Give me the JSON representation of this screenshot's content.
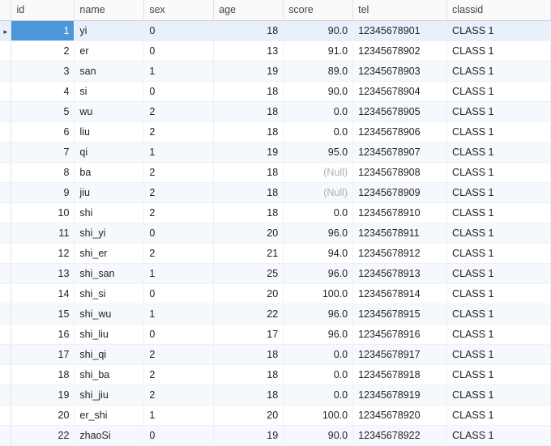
{
  "columns": {
    "id": "id",
    "name": "name",
    "sex": "sex",
    "age": "age",
    "score": "score",
    "tel": "tel",
    "classid": "classid"
  },
  "null_text": "(Null)",
  "selected_index": 0,
  "row_marker_glyph": "▸",
  "rows": [
    {
      "id": "1",
      "name": "yi",
      "sex": "0",
      "age": "18",
      "score": "90.0",
      "score_null": false,
      "tel": "12345678901",
      "classid": "CLASS 1"
    },
    {
      "id": "2",
      "name": "er",
      "sex": "0",
      "age": "13",
      "score": "91.0",
      "score_null": false,
      "tel": "12345678902",
      "classid": "CLASS 1"
    },
    {
      "id": "3",
      "name": "san",
      "sex": "1",
      "age": "19",
      "score": "89.0",
      "score_null": false,
      "tel": "12345678903",
      "classid": "CLASS 1"
    },
    {
      "id": "4",
      "name": "si",
      "sex": "0",
      "age": "18",
      "score": "90.0",
      "score_null": false,
      "tel": "12345678904",
      "classid": "CLASS 1"
    },
    {
      "id": "5",
      "name": "wu",
      "sex": "2",
      "age": "18",
      "score": "0.0",
      "score_null": false,
      "tel": "12345678905",
      "classid": "CLASS 1"
    },
    {
      "id": "6",
      "name": "liu",
      "sex": "2",
      "age": "18",
      "score": "0.0",
      "score_null": false,
      "tel": "12345678906",
      "classid": "CLASS 1"
    },
    {
      "id": "7",
      "name": "qi",
      "sex": "1",
      "age": "19",
      "score": "95.0",
      "score_null": false,
      "tel": "12345678907",
      "classid": "CLASS 1"
    },
    {
      "id": "8",
      "name": "ba",
      "sex": "2",
      "age": "18",
      "score": "",
      "score_null": true,
      "tel": "12345678908",
      "classid": "CLASS 1"
    },
    {
      "id": "9",
      "name": "jiu",
      "sex": "2",
      "age": "18",
      "score": "",
      "score_null": true,
      "tel": "12345678909",
      "classid": "CLASS 1"
    },
    {
      "id": "10",
      "name": "shi",
      "sex": "2",
      "age": "18",
      "score": "0.0",
      "score_null": false,
      "tel": "12345678910",
      "classid": "CLASS 1"
    },
    {
      "id": "11",
      "name": "shi_yi",
      "sex": "0",
      "age": "20",
      "score": "96.0",
      "score_null": false,
      "tel": "12345678911",
      "classid": "CLASS 1"
    },
    {
      "id": "12",
      "name": "shi_er",
      "sex": "2",
      "age": "21",
      "score": "94.0",
      "score_null": false,
      "tel": "12345678912",
      "classid": "CLASS 1"
    },
    {
      "id": "13",
      "name": "shi_san",
      "sex": "1",
      "age": "25",
      "score": "96.0",
      "score_null": false,
      "tel": "12345678913",
      "classid": "CLASS 1"
    },
    {
      "id": "14",
      "name": "shi_si",
      "sex": "0",
      "age": "20",
      "score": "100.0",
      "score_null": false,
      "tel": "12345678914",
      "classid": "CLASS 1"
    },
    {
      "id": "15",
      "name": "shi_wu",
      "sex": "1",
      "age": "22",
      "score": "96.0",
      "score_null": false,
      "tel": "12345678915",
      "classid": "CLASS 1"
    },
    {
      "id": "16",
      "name": "shi_liu",
      "sex": "0",
      "age": "17",
      "score": "96.0",
      "score_null": false,
      "tel": "12345678916",
      "classid": "CLASS 1"
    },
    {
      "id": "17",
      "name": "shi_qi",
      "sex": "2",
      "age": "18",
      "score": "0.0",
      "score_null": false,
      "tel": "12345678917",
      "classid": "CLASS 1"
    },
    {
      "id": "18",
      "name": "shi_ba",
      "sex": "2",
      "age": "18",
      "score": "0.0",
      "score_null": false,
      "tel": "12345678918",
      "classid": "CLASS 1"
    },
    {
      "id": "19",
      "name": "shi_jiu",
      "sex": "2",
      "age": "18",
      "score": "0.0",
      "score_null": false,
      "tel": "12345678919",
      "classid": "CLASS 1"
    },
    {
      "id": "20",
      "name": "er_shi",
      "sex": "1",
      "age": "20",
      "score": "100.0",
      "score_null": false,
      "tel": "12345678920",
      "classid": "CLASS 1"
    },
    {
      "id": "22",
      "name": "zhaoSi",
      "sex": "0",
      "age": "19",
      "score": "90.0",
      "score_null": false,
      "tel": "12345678922",
      "classid": "CLASS 1"
    }
  ]
}
